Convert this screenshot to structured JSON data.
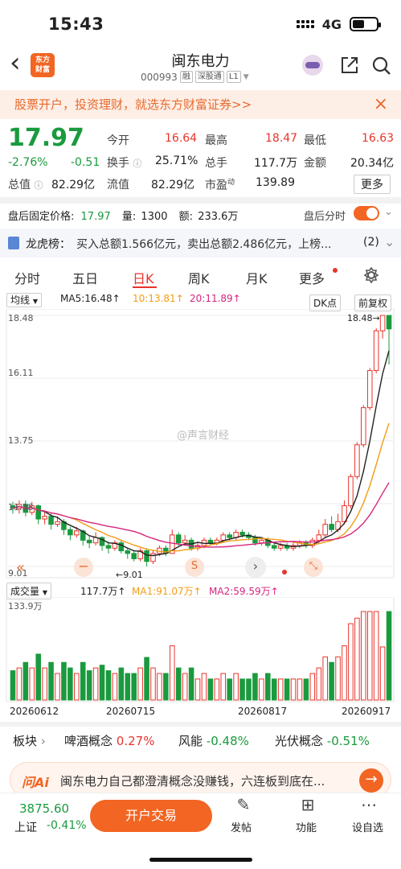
{
  "status_bar": {
    "time": "15:43",
    "network": "4G"
  },
  "header": {
    "back": "‹",
    "logo_line1": "东方",
    "logo_line2": "财富",
    "stock_name": "闽东电力",
    "stock_code": "000993",
    "tags": [
      "融",
      "深股通",
      "L1"
    ]
  },
  "banner": {
    "text": "股票开户，投资理财，就选东方财富证券>>",
    "close": "×"
  },
  "quote": {
    "price": "17.97",
    "change_pct": "-2.76%",
    "change": "-0.51",
    "open_label": "今开",
    "open": "16.64",
    "high_label": "最高",
    "high": "18.47",
    "low_label": "最低",
    "low": "16.63",
    "turnover_label": "换手",
    "turnover": "25.71%",
    "volume_label": "总手",
    "volume": "117.7万",
    "amount_label": "金额",
    "amount": "20.34亿",
    "mktcap_label": "总值",
    "mktcap": "82.29亿",
    "float_label": "流值",
    "float": "82.29亿",
    "pe_label": "市盈",
    "pe_sup": "动",
    "pe": "139.89",
    "more": "更多"
  },
  "after_hours": {
    "label": "盘后固定价格:",
    "price": "17.97",
    "vol_label": "量:",
    "vol": "1300",
    "amt_label": "额:",
    "amt": "233.6万",
    "toggle_label": "盘后分时"
  },
  "dragon": {
    "label": "龙虎榜：",
    "text": "买入总额1.566亿元，卖出总额2.486亿元，上榜...",
    "count": "(2)"
  },
  "tabs": [
    "分时",
    "五日",
    "日K",
    "周K",
    "月K",
    "更多"
  ],
  "ma_bar": {
    "type": "均线",
    "ma5": "MA5:16.48↑",
    "ma10": "10:13.81↑",
    "ma20": "20:11.89↑",
    "dk": "DK点",
    "fq": "前复权"
  },
  "kline": {
    "y_labels": [
      "18.48",
      "16.11",
      "13.75",
      "11.38",
      "9.01"
    ],
    "max_label": "18.48→",
    "min_label": "←9.01"
  },
  "volume_bar": {
    "type": "成交量",
    "vol": "117.7万↑",
    "ma1": "MA1:91.07万↑",
    "ma2": "MA2:59.59万↑",
    "max": "133.9万"
  },
  "dates": [
    "20260612",
    "20260715",
    "20260817",
    "20260917"
  ],
  "watermark": "@声言财经",
  "sectors": {
    "label": "板块",
    "items": [
      {
        "name": "啤酒概念",
        "pct": "0.27%"
      },
      {
        "name": "风能",
        "pct": "-0.48%"
      },
      {
        "name": "光伏概念",
        "pct": "-0.51%"
      }
    ]
  },
  "ai": {
    "brand": "问Ai",
    "text": "闽东电力自己都澄清概念没赚钱，六连板到底在..."
  },
  "bottom": {
    "index_value": "3875.60",
    "index_name": "上证",
    "index_pct": "-0.41%",
    "trade": "开户交易",
    "post": "发帖",
    "func": "功能",
    "self": "设自选"
  },
  "colors": {
    "up": "#e8342c",
    "down": "#1a9a3e",
    "accent": "#f26522",
    "ma5": "#222222",
    "ma10": "#f39c12",
    "ma20": "#d6247f"
  },
  "chart_data": {
    "type": "candlestick",
    "y_range": [
      9.01,
      18.48
    ],
    "ohlc": [
      [
        11.3,
        11.2,
        11.45,
        11.0
      ],
      [
        11.2,
        11.35,
        11.5,
        11.0
      ],
      [
        11.35,
        11.05,
        11.5,
        10.9
      ],
      [
        11.05,
        11.3,
        11.45,
        10.95
      ],
      [
        11.3,
        10.8,
        11.35,
        10.6
      ],
      [
        10.8,
        10.9,
        11.1,
        10.6
      ],
      [
        10.9,
        10.6,
        11.0,
        10.4
      ],
      [
        10.6,
        10.7,
        10.9,
        10.5
      ],
      [
        10.7,
        10.4,
        10.8,
        10.2
      ],
      [
        10.4,
        10.2,
        10.5,
        10.0
      ],
      [
        10.2,
        10.35,
        10.5,
        10.1
      ],
      [
        10.35,
        10.0,
        10.4,
        9.8
      ],
      [
        10.0,
        9.9,
        10.15,
        9.7
      ],
      [
        9.9,
        10.1,
        10.3,
        9.8
      ],
      [
        10.1,
        9.8,
        10.15,
        9.6
      ],
      [
        9.8,
        9.7,
        9.95,
        9.5
      ],
      [
        9.7,
        9.9,
        10.0,
        9.6
      ],
      [
        9.9,
        9.6,
        10.0,
        9.5
      ],
      [
        9.6,
        9.5,
        9.7,
        9.3
      ],
      [
        9.5,
        9.3,
        9.6,
        9.2
      ],
      [
        9.3,
        9.6,
        9.7,
        9.2
      ],
      [
        9.6,
        9.2,
        9.7,
        9.01
      ],
      [
        9.2,
        9.5,
        9.6,
        9.1
      ],
      [
        9.5,
        9.7,
        9.8,
        9.4
      ],
      [
        9.7,
        9.5,
        9.8,
        9.4
      ],
      [
        9.5,
        10.2,
        10.4,
        9.5
      ],
      [
        10.2,
        9.9,
        10.3,
        9.8
      ],
      [
        9.9,
        10.0,
        10.2,
        9.8
      ],
      [
        10.0,
        9.7,
        10.1,
        9.6
      ],
      [
        9.7,
        9.8,
        9.9,
        9.6
      ],
      [
        9.8,
        10.0,
        10.1,
        9.7
      ],
      [
        10.0,
        9.9,
        10.1,
        9.8
      ],
      [
        9.9,
        10.0,
        10.1,
        9.8
      ],
      [
        10.0,
        10.2,
        10.3,
        9.9
      ],
      [
        10.2,
        10.1,
        10.3,
        10.0
      ],
      [
        10.1,
        10.3,
        10.4,
        10.0
      ],
      [
        10.3,
        10.2,
        10.4,
        10.1
      ],
      [
        10.2,
        10.1,
        10.3,
        10.0
      ],
      [
        10.1,
        9.9,
        10.2,
        9.8
      ],
      [
        9.9,
        10.0,
        10.1,
        9.8
      ],
      [
        10.0,
        9.8,
        10.1,
        9.7
      ],
      [
        9.8,
        9.7,
        9.9,
        9.6
      ],
      [
        9.7,
        9.8,
        9.9,
        9.6
      ],
      [
        9.8,
        9.7,
        9.9,
        9.6
      ],
      [
        9.7,
        9.8,
        9.9,
        9.6
      ],
      [
        9.8,
        9.9,
        10.0,
        9.7
      ],
      [
        9.9,
        9.8,
        10.0,
        9.7
      ],
      [
        9.8,
        10.0,
        10.1,
        9.7
      ],
      [
        10.0,
        10.2,
        10.4,
        9.9
      ],
      [
        10.2,
        10.6,
        10.8,
        10.1
      ],
      [
        10.6,
        10.4,
        10.9,
        10.3
      ],
      [
        10.4,
        10.7,
        11.0,
        10.3
      ],
      [
        10.7,
        11.3,
        11.5,
        10.6
      ],
      [
        11.3,
        12.4,
        12.5,
        11.2
      ],
      [
        12.4,
        13.6,
        13.7,
        12.3
      ],
      [
        13.6,
        15.0,
        15.1,
        13.5
      ],
      [
        15.0,
        16.4,
        16.5,
        14.9
      ],
      [
        16.4,
        17.9,
        18.0,
        16.3
      ],
      [
        17.9,
        18.48,
        18.48,
        17.6
      ],
      [
        18.48,
        17.97,
        18.47,
        16.63
      ]
    ]
  }
}
